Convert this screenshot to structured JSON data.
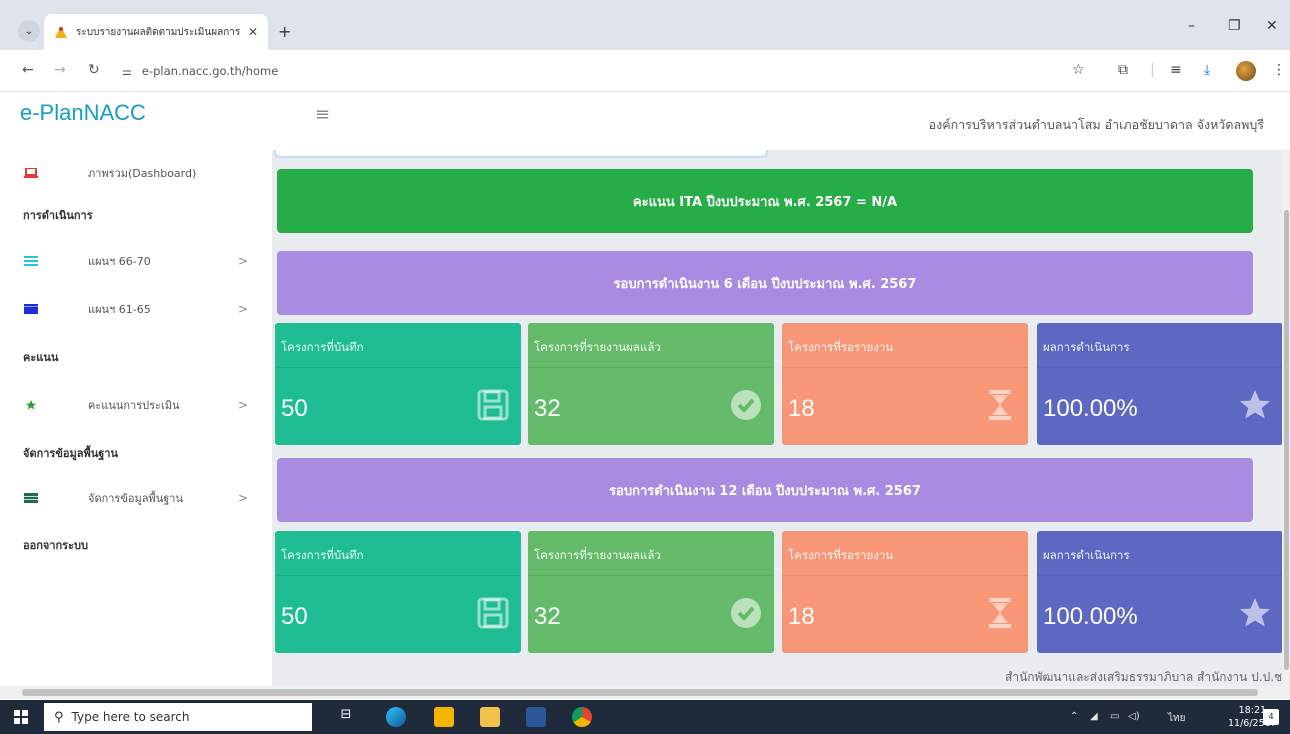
{
  "browser": {
    "tab_title": "ระบบรายงานผลติดตามประเมินผลการ",
    "tab_close": "✕",
    "new_tab": "+",
    "url": "e-plan.nacc.go.th/home",
    "win_minimize": "–",
    "win_restore": "❐",
    "win_close": "✕"
  },
  "header": {
    "logo": "e-PlanNACC",
    "org_name": "องค์การบริหารส่วนตำบลนาโสม อำเภอชัยบาดาล จังหวัดลพบุรี"
  },
  "sidebar": {
    "items": [
      {
        "type": "link",
        "label": "ภาพรวม(Dashboard)",
        "icon": "laptop-icon",
        "color": "#e53935"
      },
      {
        "type": "heading",
        "label": "การดำเนินการ"
      },
      {
        "type": "link",
        "label": "แผนฯ 66-70",
        "icon": "list-icon",
        "color": "#26c6da",
        "chevron": ">"
      },
      {
        "type": "link",
        "label": "แผนฯ 61-65",
        "icon": "calendar-icon",
        "color": "#1e2bd8",
        "chevron": ">"
      },
      {
        "type": "heading",
        "label": "คะแนน"
      },
      {
        "type": "link",
        "label": "คะแนนการประเมิน",
        "icon": "star-icon",
        "color": "#2e9e3a",
        "chevron": ">"
      },
      {
        "type": "heading",
        "label": "จัดการข้อมูลพื้นฐาน"
      },
      {
        "type": "link",
        "label": "จัดการข้อมูลพื้นฐาน",
        "icon": "table-icon",
        "color": "#1e6b5a",
        "chevron": ">"
      },
      {
        "type": "heading",
        "label": "ออกจากระบบ"
      }
    ]
  },
  "main": {
    "ita_banner": "คะแนน ITA ปีงบประมาณ พ.ศ. 2567 = N/A",
    "round6_banner": "รอบการดำเนินงาน 6 เดือน ปีงบประมาณ พ.ศ. 2567",
    "round12_banner": "รอบการดำเนินงาน 12 เดือน ปีงบประมาณ พ.ศ. 2567",
    "round6_cards": [
      {
        "title": "โครงการที่บันทึก",
        "value": "50",
        "icon": "save-icon"
      },
      {
        "title": "โครงการที่รายงานผลแล้ว",
        "value": "32",
        "icon": "check-circle-icon"
      },
      {
        "title": "โครงการที่รอรายงาน",
        "value": "18",
        "icon": "hourglass-icon"
      },
      {
        "title": "ผลการดำเนินการ",
        "value": "100.00%",
        "icon": "star-icon"
      }
    ],
    "round12_cards": [
      {
        "title": "โครงการที่บันทึก",
        "value": "50",
        "icon": "save-icon"
      },
      {
        "title": "โครงการที่รายงานผลแล้ว",
        "value": "32",
        "icon": "check-circle-icon"
      },
      {
        "title": "โครงการที่รอรายงาน",
        "value": "18",
        "icon": "hourglass-icon"
      },
      {
        "title": "ผลการดำเนินการ",
        "value": "100.00%",
        "icon": "star-icon"
      }
    ],
    "footer": "สำนักพัฒนาและส่งเสริมธรรมาภิบาล สำนักงาน ป.ป.ช."
  },
  "colors": {
    "ita_green": "#27ad47",
    "round_purple": "#a98be2",
    "card_teal": "#1ebd93",
    "card_green": "#66bb6a",
    "card_salmon": "#f79778",
    "card_indigo": "#5c68c2",
    "logo_blue": "#149dc8"
  },
  "taskbar": {
    "search_placeholder": "Type here to search",
    "language": "ไทย",
    "time": "18:21",
    "date": "11/6/2567",
    "notifications": "4"
  }
}
